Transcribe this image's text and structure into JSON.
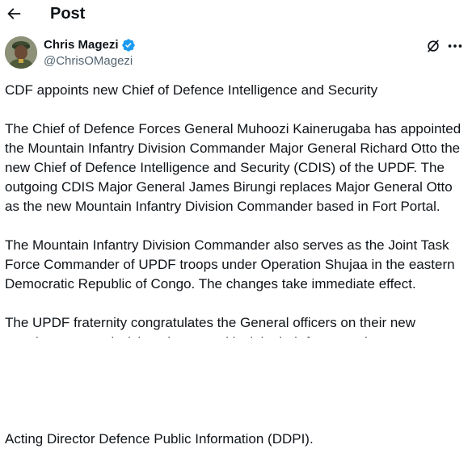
{
  "header": {
    "title": "Post",
    "back_icon": "arrow-left-icon"
  },
  "author": {
    "name": "Chris Magezi",
    "handle": "@ChrisOMagezi",
    "verified": true,
    "verified_color": "#1d9bf0"
  },
  "actions": {
    "grok_icon": "grok-icon",
    "more_icon": "more-horizontal-icon"
  },
  "post": {
    "paragraphs": [
      "CDF appoints new Chief of Defence Intelligence and Security",
      "The Chief of Defence Forces General Muhoozi Kainerugaba has appointed the Mountain Infantry Division Commander Major General Richard Otto the new Chief of Defence Intelligence and Security (CDIS) of the UPDF. The outgoing CDIS Major General James Birungi replaces Major General Otto as the new Mountain Infantry Division Commander based in Fort Portal.",
      "The Mountain Infantry Division Commander also serves as the Joint Task Force Commander of UPDF troops under Operation Shujaa in the eastern Democratic Republic of Congo. The changes take immediate effect.",
      "The UPDF fraternity congratulates the General officers on their new appointments and wishes them good luck in their future endeavors."
    ],
    "signature": "Acting Director Defence Public Information (DDPI)."
  }
}
